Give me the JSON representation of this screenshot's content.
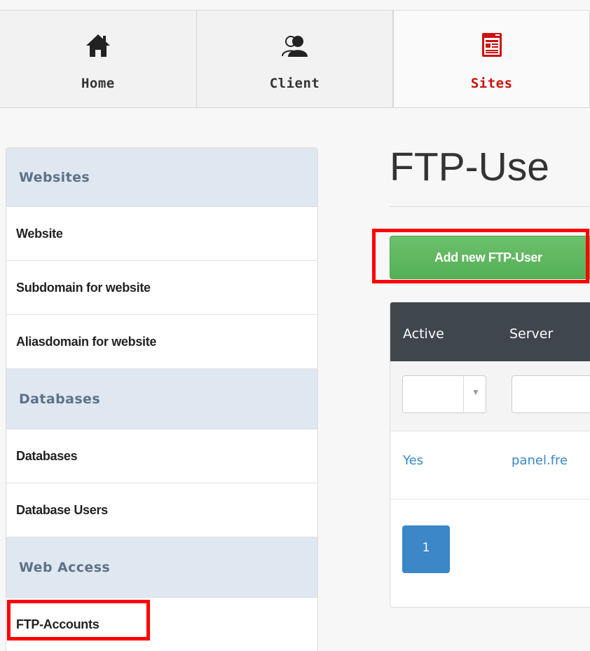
{
  "nav": {
    "tabs": [
      {
        "label": "Home",
        "icon": "home-icon"
      },
      {
        "label": "Client",
        "icon": "client-icon"
      },
      {
        "label": "Sites",
        "icon": "sites-icon",
        "active": true
      }
    ]
  },
  "sidebar": {
    "sections": [
      {
        "title": "Websites",
        "items": [
          "Website",
          "Subdomain for website",
          "Aliasdomain for website"
        ]
      },
      {
        "title": "Databases",
        "items": [
          "Databases",
          "Database Users"
        ]
      },
      {
        "title": "Web Access",
        "items": [
          "FTP-Accounts"
        ]
      }
    ]
  },
  "main": {
    "title": "FTP-Use",
    "add_button": "Add new FTP-User",
    "table": {
      "headers": [
        "Active",
        "Server"
      ],
      "rows": [
        [
          "Yes",
          "panel.fre"
        ]
      ]
    },
    "pagination": {
      "current": "1"
    }
  },
  "colors": {
    "active_tab": "#cc1010",
    "button_green": "#5cb85c",
    "link_blue": "#3a87c8",
    "highlight_red": "#ff0000"
  }
}
